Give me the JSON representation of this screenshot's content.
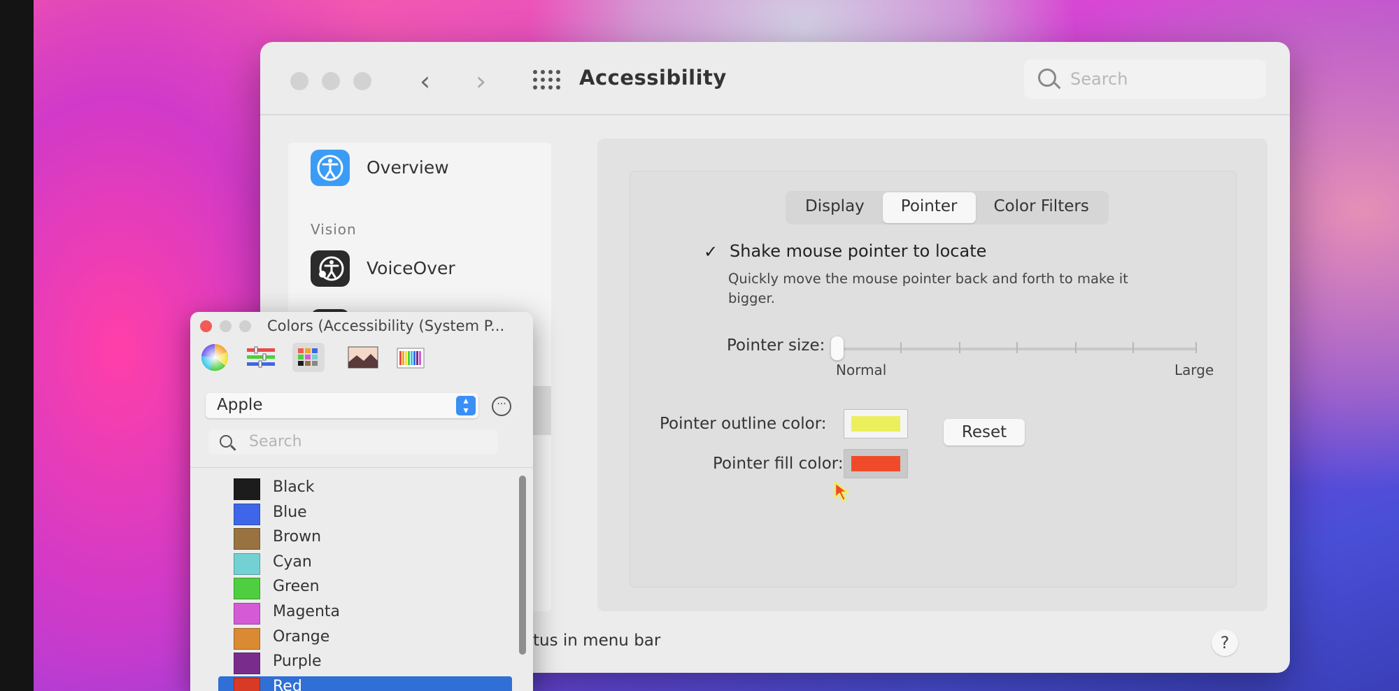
{
  "window": {
    "title": "Accessibility",
    "search_placeholder": "Search",
    "back_icon": "chevron-left-icon",
    "forward_icon": "chevron-right-icon"
  },
  "sidebar": {
    "items": [
      {
        "label": "Overview",
        "icon": "accessibility-icon",
        "icon_color": "#3b9cf5"
      },
      {
        "label": "VoiceOver",
        "icon": "voiceover-icon",
        "icon_color": "#2b2b2b"
      }
    ],
    "sections": [
      {
        "label": "Vision"
      }
    ]
  },
  "tabs": [
    {
      "label": "Display",
      "active": false
    },
    {
      "label": "Pointer",
      "active": true
    },
    {
      "label": "Color Filters",
      "active": false
    }
  ],
  "pointer": {
    "shake_label": "Shake mouse pointer to locate",
    "shake_checked": true,
    "shake_description": "Quickly move the mouse pointer back and forth to make it bigger.",
    "size_label": "Pointer size:",
    "size_min_label": "Normal",
    "size_max_label": "Large",
    "size_value_fraction": 0.0,
    "outline_label": "Pointer outline color:",
    "outline_color": "#ecef5c",
    "fill_label": "Pointer fill color:",
    "fill_color": "#ef4b2b",
    "reset_label": "Reset"
  },
  "footer": {
    "status_text": "tus in menu bar",
    "help_label": "?"
  },
  "colors_panel": {
    "title": "Colors (Accessibility (System P...",
    "palette_name": "Apple",
    "search_placeholder": "Search",
    "colors": [
      {
        "name": "Black",
        "hex": "#1c1c1c"
      },
      {
        "name": "Blue",
        "hex": "#3f66e8"
      },
      {
        "name": "Brown",
        "hex": "#98723f"
      },
      {
        "name": "Cyan",
        "hex": "#74d1d3"
      },
      {
        "name": "Green",
        "hex": "#4fcf3f"
      },
      {
        "name": "Magenta",
        "hex": "#d55ad6"
      },
      {
        "name": "Orange",
        "hex": "#d98a32"
      },
      {
        "name": "Purple",
        "hex": "#7a2c8c"
      },
      {
        "name": "Red",
        "hex": "#d83a25",
        "selected": true
      }
    ]
  }
}
